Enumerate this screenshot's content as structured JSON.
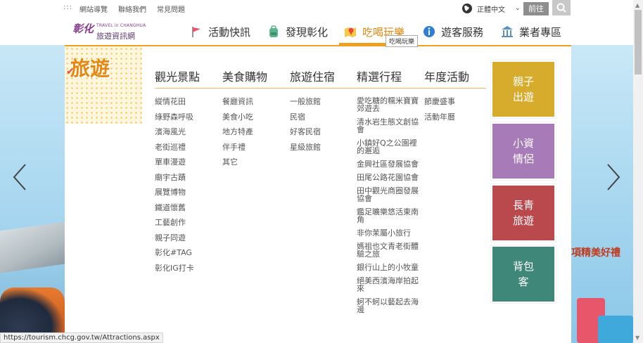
{
  "utility_bar": {
    "dots": ":::",
    "links": [
      "網站導覽",
      "聯絡我們",
      "常見問題"
    ],
    "language": "正體中文",
    "go_label": "前往"
  },
  "logo": {
    "mark": "彰化",
    "english": "TRAVEL in CHANGHUA",
    "chinese": "旅遊資訊網"
  },
  "nav": [
    {
      "label": "活動快訊",
      "icon": "flag-icon"
    },
    {
      "label": "發現彰化",
      "icon": "backpack-icon"
    },
    {
      "label": "吃喝玩樂",
      "icon": "map-pin-icon",
      "active": true
    },
    {
      "label": "遊客服務",
      "icon": "info-icon"
    },
    {
      "label": "業者專區",
      "icon": "building-icon"
    }
  ],
  "tooltip": "吃喝玩樂",
  "menu": {
    "badge": "旅遊",
    "columns": [
      {
        "title": "觀光景點",
        "items": [
          "縱情花田",
          "綠野森呼吸",
          "濱海風光",
          "老街巡禮",
          "單車漫遊",
          "廟宇古蹟",
          "展覽博物",
          "鐵道懷舊",
          "工藝創作",
          "親子同遊",
          "彰化#TAG",
          "彰化IG打卡"
        ]
      },
      {
        "title": "美食購物",
        "items": [
          "餐廳資訊",
          "美食小吃",
          "地方特產",
          "伴手禮",
          "其它"
        ]
      },
      {
        "title": "旅遊住宿",
        "items": [
          "一般旅館",
          "民宿",
          "好客民宿",
          "星級旅館"
        ]
      },
      {
        "title": "精選行程",
        "items": [
          "愛吃糖的糯米寶寶郊遊去",
          "清水岩生態文創協會",
          "小鎮好Q之公園裡的邂逅",
          "金興社區發展協會",
          "田尾公路花園協會",
          "田中觀光商圈發展協會",
          "鑑足曠樂悠活東南角",
          "非你茉屬小旅行",
          "媽祖也文青老街體驗之旅",
          "銀行山上的小牧童",
          "絕美西濱海岸拍起來",
          "蚵不蚵以藝起去海邊"
        ]
      },
      {
        "title": "年度活動",
        "items": [
          "節慶盛事",
          "活動年曆"
        ]
      }
    ],
    "tiles": [
      {
        "label": "親子出遊",
        "color": "#d7ac2c"
      },
      {
        "label": "小資情侶",
        "color": "#a77bb8"
      },
      {
        "label": "長青旅遊",
        "color": "#b9494d"
      },
      {
        "label": "背包客",
        "color": "#3f8879"
      }
    ]
  },
  "background": {
    "promo_text": "項精美好禮"
  },
  "status_bar": "https://tourism.chcg.gov.tw/Attractions.aspx",
  "colors": {
    "accent_orange": "#f0a021",
    "active_nav": "#e8870d",
    "tile_yellow": "#d7ac2c",
    "tile_purple": "#a77bb8",
    "tile_red": "#b9494d",
    "tile_green": "#3f8879"
  }
}
